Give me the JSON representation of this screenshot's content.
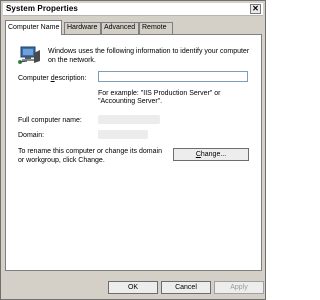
{
  "window": {
    "title": "System Properties",
    "close_symbol": "✕"
  },
  "tabs": [
    {
      "label": "Computer Name",
      "active": true
    },
    {
      "label": "Hardware",
      "active": false
    },
    {
      "label": "Advanced",
      "active": false
    },
    {
      "label": "Remote",
      "active": false
    }
  ],
  "computer_name": {
    "icon": "computer-network-icon",
    "intro": "Windows uses the following information to identify your computer on the network.",
    "description_label_pre": "Computer ",
    "description_label_key": "d",
    "description_label_post": "escription:",
    "description_value": "",
    "example": "For example: \"IIS Production Server\" or \"Accounting Server\".",
    "full_name_label": "Full computer name:",
    "domain_label": "Domain:",
    "rename_text": "To rename this computer or change its domain or workgroup, click Change.",
    "change_button_pre": "",
    "change_button_key": "C",
    "change_button_post": "hange..."
  },
  "footer": {
    "ok_label": "OK",
    "cancel_label": "Cancel",
    "apply_label": "Apply"
  }
}
